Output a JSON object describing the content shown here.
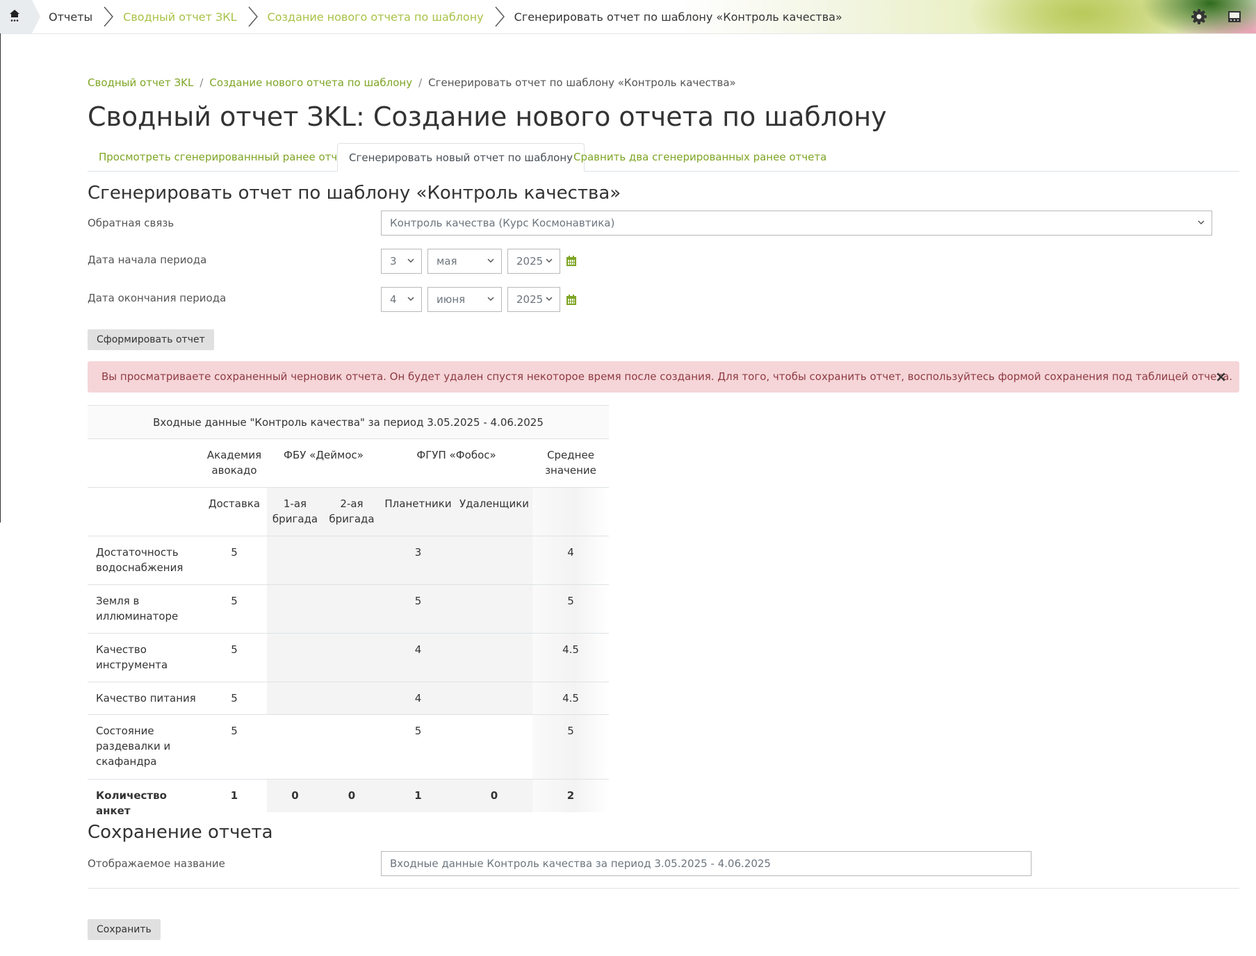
{
  "navbar": {
    "home_label": "Home",
    "items": [
      {
        "label": "Отчеты"
      },
      {
        "label": "Сводный отчет ЗКL"
      },
      {
        "label": "Создание нового отчета по шаблону"
      },
      {
        "label": "Сгенерировать отчет по шаблону «Контроль качества»"
      }
    ],
    "icons": [
      "gear-icon",
      "hide-blocks-icon"
    ]
  },
  "breadcrumb": {
    "items": [
      {
        "label": "Сводный отчет ЗKL"
      },
      {
        "label": "Создание нового отчета по шаблону"
      },
      {
        "label": "Сгенерировать отчет по шаблону «Контроль качества»"
      }
    ],
    "separator": "/"
  },
  "page_title": "Сводный отчет ЗKL: Создание нового отчета по шаблону",
  "tabs": [
    {
      "label": "Просмотреть сгенерированнный ранее отчет"
    },
    {
      "label": "Сгенерировать новый отчет по шаблону",
      "active": true
    },
    {
      "label": "Сравнить два сгенерированных ранее отчета"
    }
  ],
  "form": {
    "heading": "Сгенерировать отчет по шаблону «Контроль качества»",
    "feedback_label": "Обратная связь",
    "feedback_value": "Контроль качества (Курс Космонавтика)",
    "start_label": "Дата начала периода",
    "start": {
      "day": "3",
      "month": "мая",
      "year": "2025"
    },
    "end_label": "Дата окончания периода",
    "end": {
      "day": "4",
      "month": "июня",
      "year": "2025"
    },
    "submit_label": "Сформировать отчет"
  },
  "alert": {
    "text": "Вы просматриваете сохраненный черновик отчета. Он будет удален спустя некоторое время после создания. Для того, чтобы сохранить отчет, воспользуйтесь формой сохранения под таблицей отчета.",
    "close": "×"
  },
  "table": {
    "caption": "Входные данные \"Контроль качества\" за период 3.05.2025 - 4.06.2025",
    "groups": [
      "Академия авокадо",
      "ФБУ «Деймос»",
      "ФГУП «Фобос»",
      "Среднее значение"
    ],
    "subgroups": [
      "Доставка",
      "1-ая бригада",
      "2-ая бригада",
      "Планетники",
      "Удаленщики"
    ],
    "rows": [
      {
        "label": "Достаточность водоснабжения",
        "values": [
          "5",
          "",
          "",
          "3",
          "",
          "4"
        ]
      },
      {
        "label": "Земля в иллюминаторе",
        "values": [
          "5",
          "",
          "",
          "5",
          "",
          "5"
        ]
      },
      {
        "label": "Качество инструмента",
        "values": [
          "5",
          "",
          "",
          "4",
          "",
          "4.5"
        ]
      },
      {
        "label": "Качество питания",
        "values": [
          "5",
          "",
          "",
          "4",
          "",
          "4.5"
        ]
      },
      {
        "label": "Состояние раздевалки и скафандра",
        "values": [
          "5",
          "",
          "",
          "5",
          "",
          "5"
        ]
      }
    ],
    "footer": {
      "label": "Количество анкет",
      "values": [
        "1",
        "0",
        "0",
        "1",
        "0",
        "2"
      ]
    }
  },
  "save": {
    "heading": "Сохранение отчета",
    "name_label": "Отображаемое название",
    "name_value": "Входные данные Контроль качества за период 3.05.2025 - 4.06.2025",
    "button_label": "Сохранить"
  },
  "colors": {
    "accent": "#7ea525",
    "alert_bg": "#f5d5d8",
    "alert_text": "#8f3b43"
  }
}
